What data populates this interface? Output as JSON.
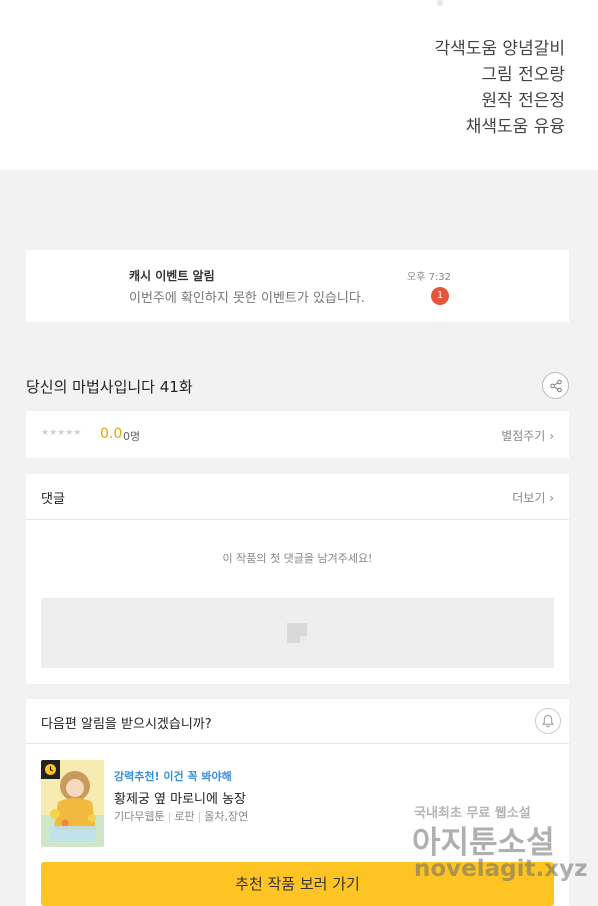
{
  "credits": [
    "각색도움 양념갈비",
    "그림 전오랑",
    "원작 전은정",
    "채색도움 유융"
  ],
  "notice": {
    "title": "캐시 이벤트 알림",
    "body": "이번주에 확인하지 못한 이벤트가 있습니다.",
    "time": "오후 7:32",
    "badge": "1"
  },
  "episode": {
    "title": "당신의 마법사입니다 41화",
    "share_icon": "share-icon"
  },
  "rating": {
    "stars": "★★★★★",
    "score": "0.0",
    "count": "0명",
    "rate_label": "별점주기"
  },
  "comments": {
    "title": "댓글",
    "more_label": "더보기",
    "empty_message": "이 작품의 첫 댓글을 남겨주세요!"
  },
  "next_episode": {
    "question": "다음편 알림을 받으시겠습니까?",
    "bell_icon": "bell-icon"
  },
  "recommendation": {
    "tag": "강력추천! 이건 꼭 봐야해",
    "title": "황제궁 옆 마로니에 농장",
    "meta": [
      "기다무웹툰",
      "로판",
      "올차,장연"
    ],
    "button_label": "추천 작품 보러 가기"
  },
  "watermark": {
    "line1": "국내최초 무료 웹소설",
    "line2": "아지툰소설",
    "line3": "novelagit.xyz"
  },
  "colors": {
    "accent_yellow": "#fdc423",
    "badge_red": "#e4553b",
    "score_gold": "#e2a400",
    "link_blue": "#3b8fd8"
  }
}
